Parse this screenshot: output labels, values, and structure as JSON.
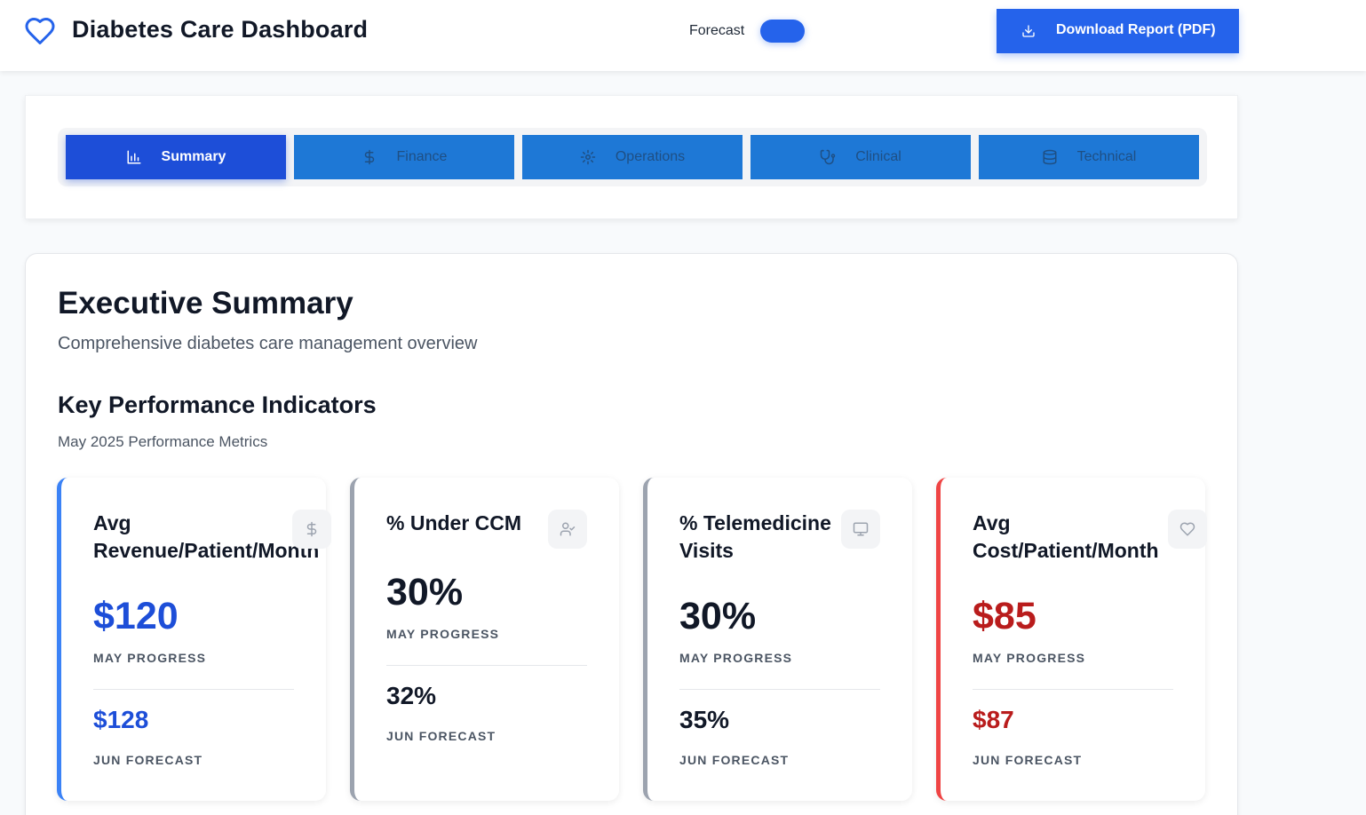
{
  "header": {
    "title": "Diabetes Care Dashboard",
    "logo_icon": "heart-icon",
    "forecast_label": "Forecast",
    "forecast_toggle_on": true,
    "download_label": "Download Report (PDF)",
    "download_icon": "download-icon",
    "accent_color": "#2563eb"
  },
  "tabs": [
    {
      "label": "Summary",
      "icon": "bar-chart-icon",
      "active": true
    },
    {
      "label": "Finance",
      "icon": "dollar-icon",
      "active": false
    },
    {
      "label": "Operations",
      "icon": "gear-icon",
      "active": false
    },
    {
      "label": "Clinical",
      "icon": "stethoscope-icon",
      "active": false
    },
    {
      "label": "Technical",
      "icon": "database-icon",
      "active": false
    }
  ],
  "main": {
    "title": "Executive Summary",
    "subtitle": "Comprehensive diabetes care management overview",
    "kpi_title": "Key Performance Indicators",
    "kpi_subtitle": "May 2025 Performance Metrics"
  },
  "cards": [
    {
      "title": "Avg Revenue/Patient/Month",
      "icon": "dollar-icon",
      "value": "$120",
      "value_label": "MAY PROGRESS",
      "forecast": "$128",
      "forecast_label": "JUN FORECAST",
      "color": "#1d4ed8",
      "border": "#3b82f6"
    },
    {
      "title": "% Under CCM",
      "icon": "user-check-icon",
      "value": "30%",
      "value_label": "MAY PROGRESS",
      "forecast": "32%",
      "forecast_label": "JUN FORECAST",
      "color": "#111827",
      "border": "#9ca3af"
    },
    {
      "title": "% Telemedicine Visits",
      "icon": "monitor-icon",
      "value": "30%",
      "value_label": "MAY PROGRESS",
      "forecast": "35%",
      "forecast_label": "JUN FORECAST",
      "color": "#111827",
      "border": "#9ca3af"
    },
    {
      "title": "Avg Cost/Patient/Month",
      "icon": "heart-icon",
      "value": "$85",
      "value_label": "MAY PROGRESS",
      "forecast": "$87",
      "forecast_label": "JUN FORECAST",
      "color": "#b91c1c",
      "border": "#ef4444"
    }
  ]
}
